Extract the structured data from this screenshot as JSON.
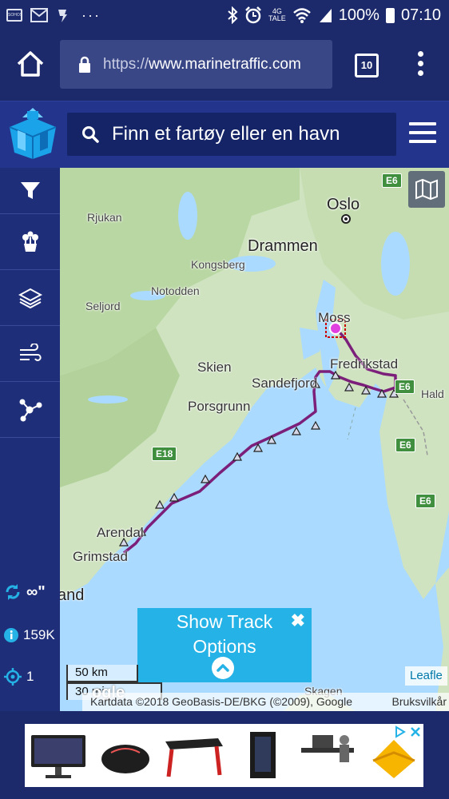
{
  "status_bar": {
    "network_small_top": "4G",
    "network_small_bottom": "TALE",
    "battery": "100%",
    "time": "07:10",
    "dots": "···"
  },
  "browser": {
    "url_scheme": "https://",
    "url_host": "www.marinetraffic.com",
    "tab_count": "10"
  },
  "header": {
    "search_placeholder": "Finn et fartøy eller en havn"
  },
  "sidebar": {
    "refresh_label": "∞\"",
    "vessel_count": "159K",
    "tracked_count": "1"
  },
  "map": {
    "labels": {
      "oslo": "Oslo",
      "drammen": "Drammen",
      "kongsberg": "Kongsberg",
      "notodden": "Notodden",
      "rjukan": "Rjukan",
      "seljord": "Seljord",
      "moss": "Moss",
      "fredrikstad": "Fredrikstad",
      "halden": "Hald",
      "skien": "Skien",
      "sandefjord": "Sandefjord",
      "porsgrunn": "Porsgrunn",
      "arendal": "Arendal",
      "grimstad": "Grimstad",
      "land": "and",
      "skagen": "Skagen"
    },
    "roads": {
      "e6_top": "E6",
      "e6_mid": "E6",
      "e6_lower": "E6",
      "e6_bottom": "E6",
      "e18": "E18"
    },
    "track_panel": {
      "title": "Show Track Options",
      "close": "✖"
    },
    "scale_km": "50 km",
    "scale_mi": "30 mi",
    "attribution": "Kartdata ©2018 GeoBasis-DE/BKG (©2009), Google",
    "terms": "Bruksvilkår",
    "leaflet": "Leafle",
    "google_partial": "ogle"
  },
  "colors": {
    "status_bar": "#1c2a6b",
    "header": "#23348c",
    "track_line": "#7b1f7a",
    "panel": "#25b2e6",
    "sea": "#aadaff"
  }
}
